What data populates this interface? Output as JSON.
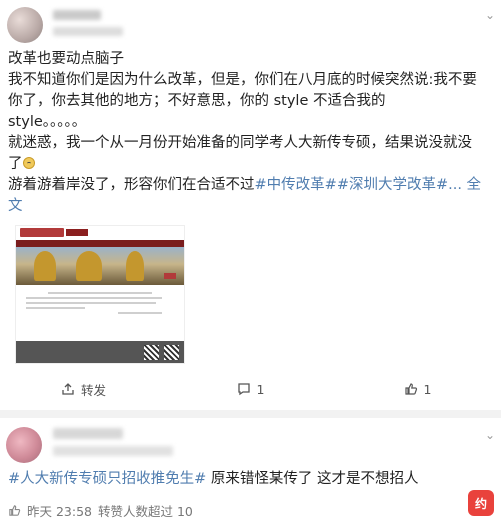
{
  "post1": {
    "lines": [
      "改革也要动点脑子",
      "我不知道你们是因为什么改革，但是，你们在八月底的时候突然说:我不要",
      "你了，你去其他的地方；不好意思，你的 style 不适合我的",
      "style。。。。。",
      "就迷惑，我一个从一月份开始准备的同学考人大新传专硕，结果说没就没",
      "了"
    ],
    "last_line_prefix": "游着游着岸没了，形容你们在合适不过",
    "tags": [
      "#中传改革#",
      "#深圳大学改革#"
    ],
    "more": "... 全",
    "more_wrap": "文",
    "actions": {
      "repost": "转发",
      "comment_count": "1",
      "like_count": "1"
    }
  },
  "post2": {
    "tag": "#人大新传专硕只招收推免生#",
    "text": " 原来错怪某传了 这才是不想招人",
    "time": "昨天 23:58",
    "likes": "转赞人数超过 10"
  },
  "watermark": "约"
}
